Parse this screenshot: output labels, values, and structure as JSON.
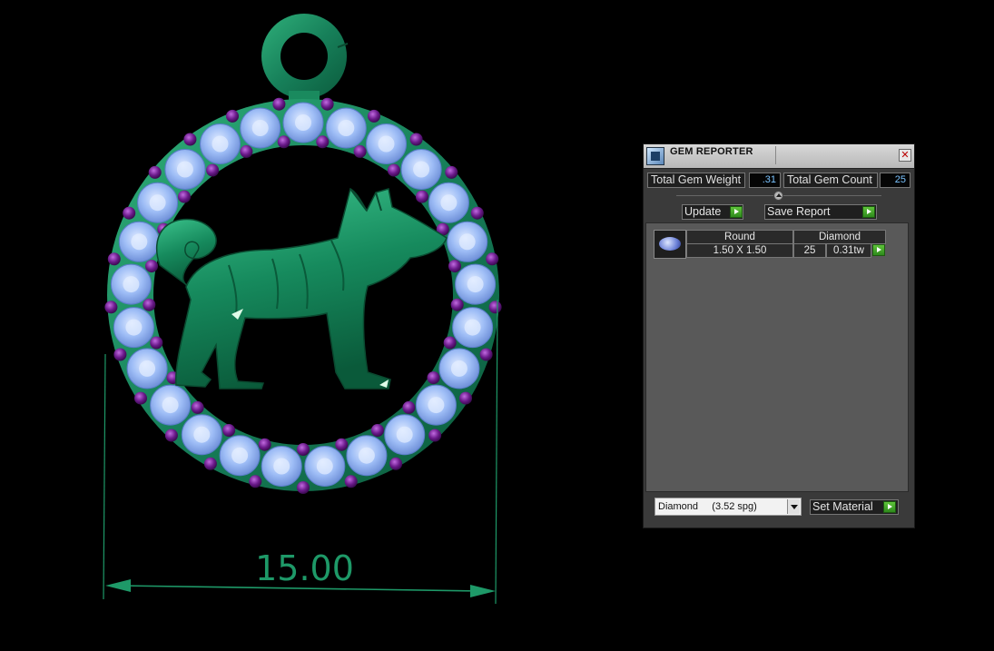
{
  "viewport": {
    "dimension_value": "15.00",
    "colors": {
      "metal": "#1f8f62",
      "gem": "#8fb6f5",
      "accent_gem": "#6a1a8a",
      "dimension": "#1e9968"
    }
  },
  "panel": {
    "title": "GEM REPORTER",
    "icon": "gem-reporter-icon",
    "close_icon": "close-icon",
    "total_weight_label": "Total Gem Weight",
    "total_weight_value": ".31",
    "total_count_label": "Total Gem Count",
    "total_count_value": "25",
    "update_label": "Update",
    "save_report_label": "Save Report",
    "rows": [
      {
        "shape": "Round",
        "material": "Diamond",
        "size": "1.50 X 1.50",
        "count": "25",
        "weight": "0.31tw"
      }
    ],
    "material_select": "Diamond     (3.52 spg)",
    "set_material_label": "Set Material"
  }
}
